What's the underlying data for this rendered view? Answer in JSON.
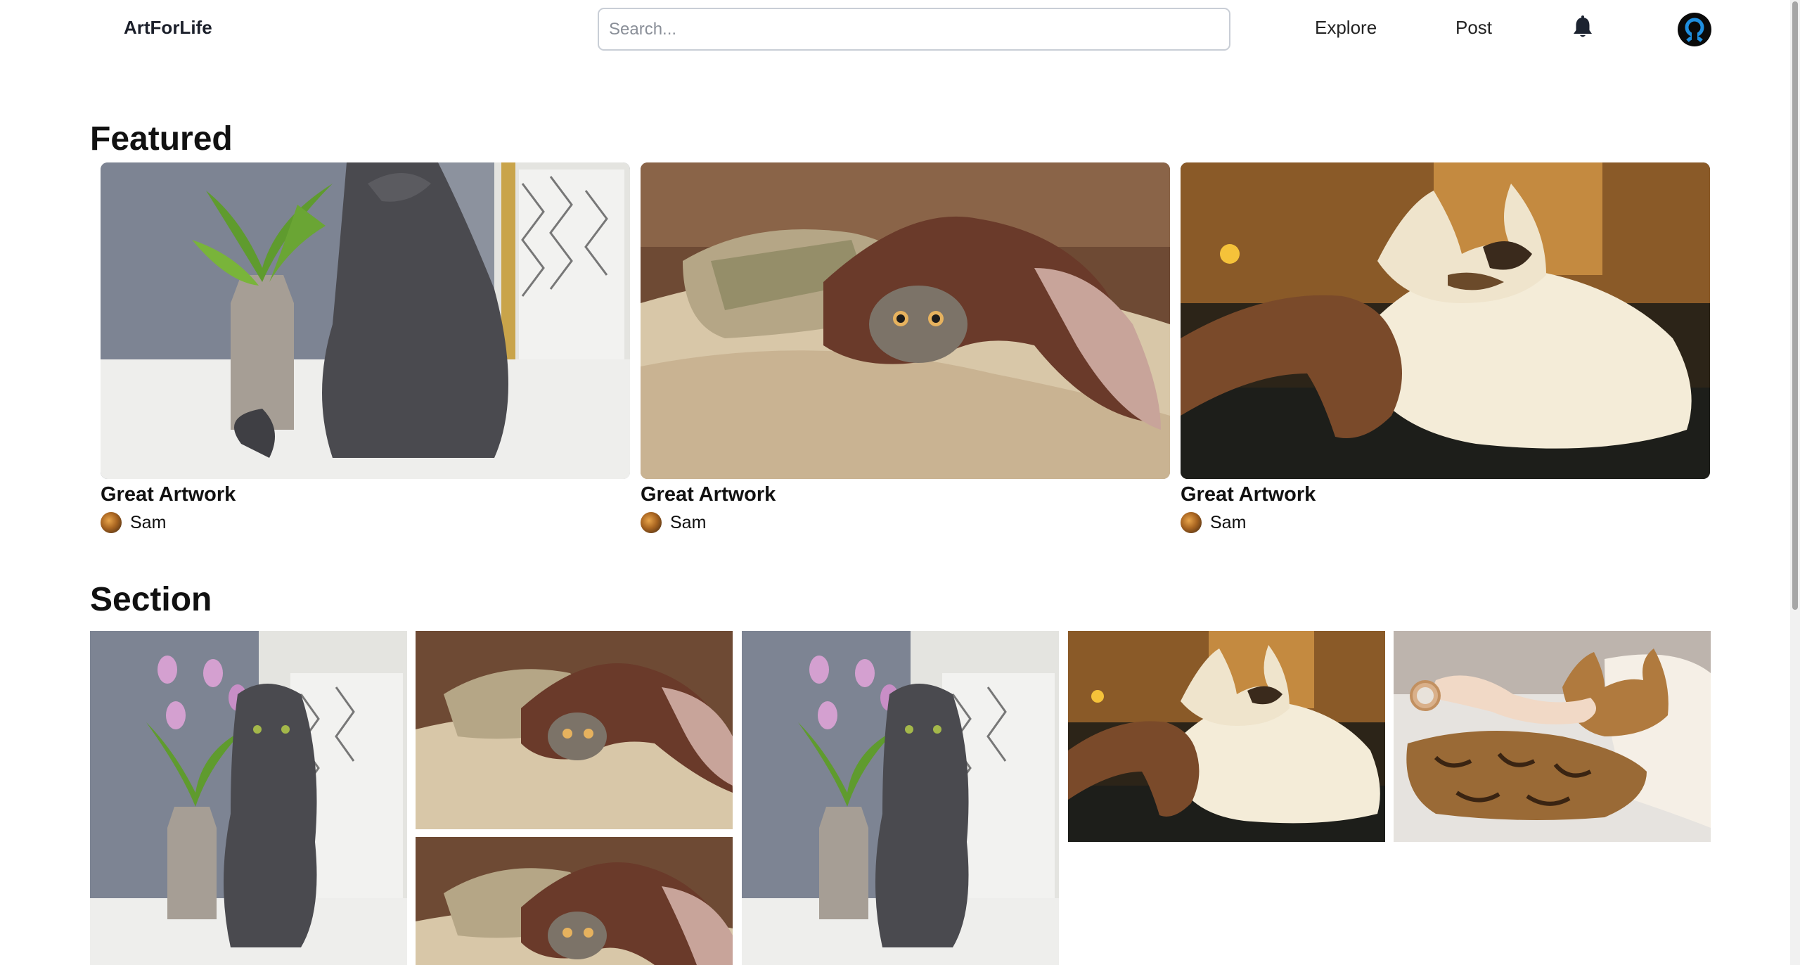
{
  "header": {
    "brand": "ArtForLife",
    "search_placeholder": "Search...",
    "nav": {
      "explore": "Explore",
      "post": "Post"
    },
    "icons": {
      "notifications": "bell-icon",
      "profile": "user-avatar-icon"
    }
  },
  "featured": {
    "heading": "Featured",
    "cards": [
      {
        "title": "Great Artwork",
        "author": "Sam",
        "image": "grey-cat-with-plant"
      },
      {
        "title": "Great Artwork",
        "author": "Sam",
        "image": "tabby-cat-under-blanket"
      },
      {
        "title": "Great Artwork",
        "author": "Sam",
        "image": "calico-cat-being-petted"
      }
    ]
  },
  "section": {
    "heading": "Section",
    "tiles": [
      {
        "image": "grey-cat-with-tulips"
      },
      {
        "image": "tabby-cat-under-blanket"
      },
      {
        "image": "tabby-cat-under-blanket"
      },
      {
        "image": "grey-cat-with-tulips"
      },
      {
        "image": "calico-cat-being-petted"
      },
      {
        "image": "bengal-cat-being-petted"
      }
    ]
  },
  "colors": {
    "text": "#111111",
    "search_border": "#c9ced6",
    "avatar_ring": "#1f8fe0"
  }
}
